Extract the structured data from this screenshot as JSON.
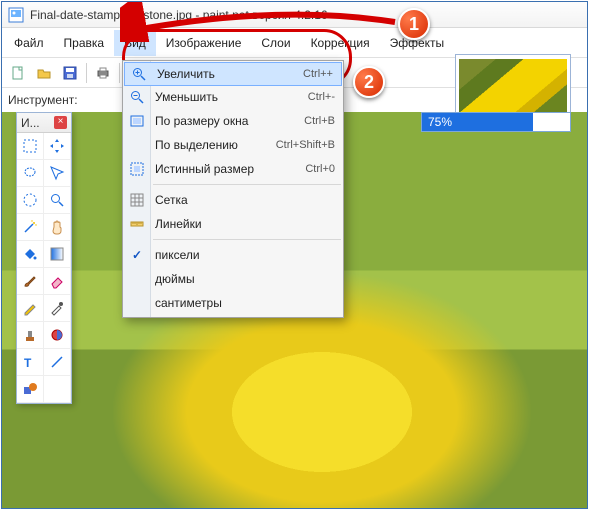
{
  "window": {
    "title": "Final-date-stamp-faststone.jpg - paint.net версия 4.2.16"
  },
  "menubar": {
    "items": [
      "Файл",
      "Правка",
      "Вид",
      "Изображение",
      "Слои",
      "Коррекция",
      "Эффекты"
    ],
    "active_index": 2
  },
  "toolbar": {
    "icons": [
      "new-file-icon",
      "open-icon",
      "save-icon",
      "print-icon",
      "zoom-in-icon"
    ]
  },
  "status": {
    "instrument_label": "Инструмент:"
  },
  "progress": {
    "percent_text": "75%",
    "percent_value": 75
  },
  "tools_panel": {
    "title": "И..."
  },
  "dropdown": {
    "items": [
      {
        "label": "Увеличить",
        "shortcut": "Ctrl++",
        "icon": "zoom-in-icon",
        "selected": true
      },
      {
        "label": "Уменьшить",
        "shortcut": "Ctrl+-",
        "icon": "zoom-out-icon"
      },
      {
        "label": "По размеру окна",
        "shortcut": "Ctrl+B",
        "icon": "fit-window-icon"
      },
      {
        "label": "По выделению",
        "shortcut": "Ctrl+Shift+B",
        "icon": ""
      },
      {
        "label": "Истинный размер",
        "shortcut": "Ctrl+0",
        "icon": "actual-size-icon"
      },
      {
        "sep": true
      },
      {
        "label": "Сетка",
        "shortcut": "",
        "icon": "grid-icon"
      },
      {
        "label": "Линейки",
        "shortcut": "",
        "icon": "ruler-icon"
      },
      {
        "sep": true
      },
      {
        "label": "пиксели",
        "shortcut": "",
        "checked": true
      },
      {
        "label": "дюймы",
        "shortcut": ""
      },
      {
        "label": "сантиметры",
        "shortcut": ""
      }
    ]
  },
  "callouts": {
    "one": "1",
    "two": "2"
  }
}
